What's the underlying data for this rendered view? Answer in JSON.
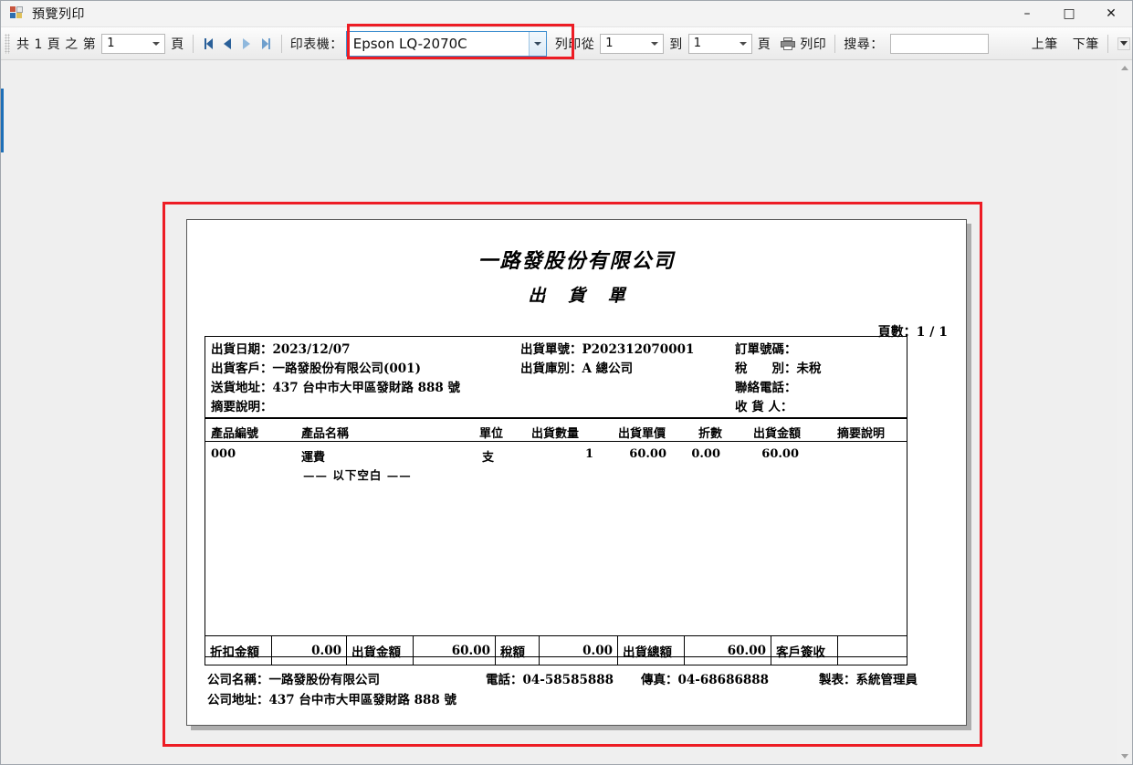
{
  "window": {
    "title": "預覽列印",
    "icon": "preview-print-icon",
    "minimize": "–",
    "maximize": "□",
    "close": "✕"
  },
  "toolbar": {
    "page_prefix": "共 1 頁 之 第",
    "page_value": "1",
    "page_suffix": "頁",
    "nav": {
      "first": "first-page-icon",
      "prev": "previous-page-icon",
      "next": "next-page-icon",
      "last": "last-page-icon"
    },
    "printer_label": "印表機：",
    "printer_value": "Epson LQ-2070C",
    "print_from_label": "列印從",
    "print_from_value": "1",
    "print_to_label": "到",
    "print_to_value": "1",
    "print_pages_suffix": "頁",
    "print_button": "列印",
    "search_label": "搜尋：",
    "search_value": "",
    "prev_match": "上筆",
    "next_match": "下筆",
    "highlight_color": "#ed1c24"
  },
  "report": {
    "company_title": "一路發股份有限公司",
    "doc_title": "出 貨 單",
    "page_number_label": "頁數：1 / 1",
    "header_left": [
      "出貨日期：2023/12/07",
      "出貨客戶：一路發股份有限公司(001)",
      "送貨地址：437 台中市大甲區發財路 888 號",
      "摘要說明："
    ],
    "header_mid": [
      "出貨單號：P202312070001",
      "出貨庫別：A 總公司"
    ],
    "header_right": [
      "訂單號碼：",
      "稅　　別：未稅",
      "聯絡電話：",
      "收 貨 人："
    ],
    "columns": [
      "產品編號",
      "產品名稱",
      "單位",
      "出貨數量",
      "出貨單價",
      "折數",
      "出貨金額",
      "摘要說明"
    ],
    "rows": [
      {
        "code": "000",
        "name": "運費",
        "unit": "支",
        "qty": "1",
        "price": "60.00",
        "discount": "0.00",
        "amount": "60.00",
        "note": ""
      }
    ],
    "end_marker": "—— 以下空白 ——",
    "totals": [
      {
        "label": "折扣金額",
        "value": "0.00"
      },
      {
        "label": "出貨金額",
        "value": "60.00"
      },
      {
        "label": "稅額",
        "value": "0.00"
      },
      {
        "label": "出貨總額",
        "value": "60.00"
      },
      {
        "label": "客戶簽收",
        "value": ""
      }
    ],
    "footer": {
      "company_name": "公司名稱：一路發股份有限公司",
      "phone": "電話：04-58585888",
      "fax": "傳真：04-68686888",
      "maker": "製表：系統管理員",
      "company_address": "公司地址：437 台中市大甲區發財路 888 號"
    }
  }
}
